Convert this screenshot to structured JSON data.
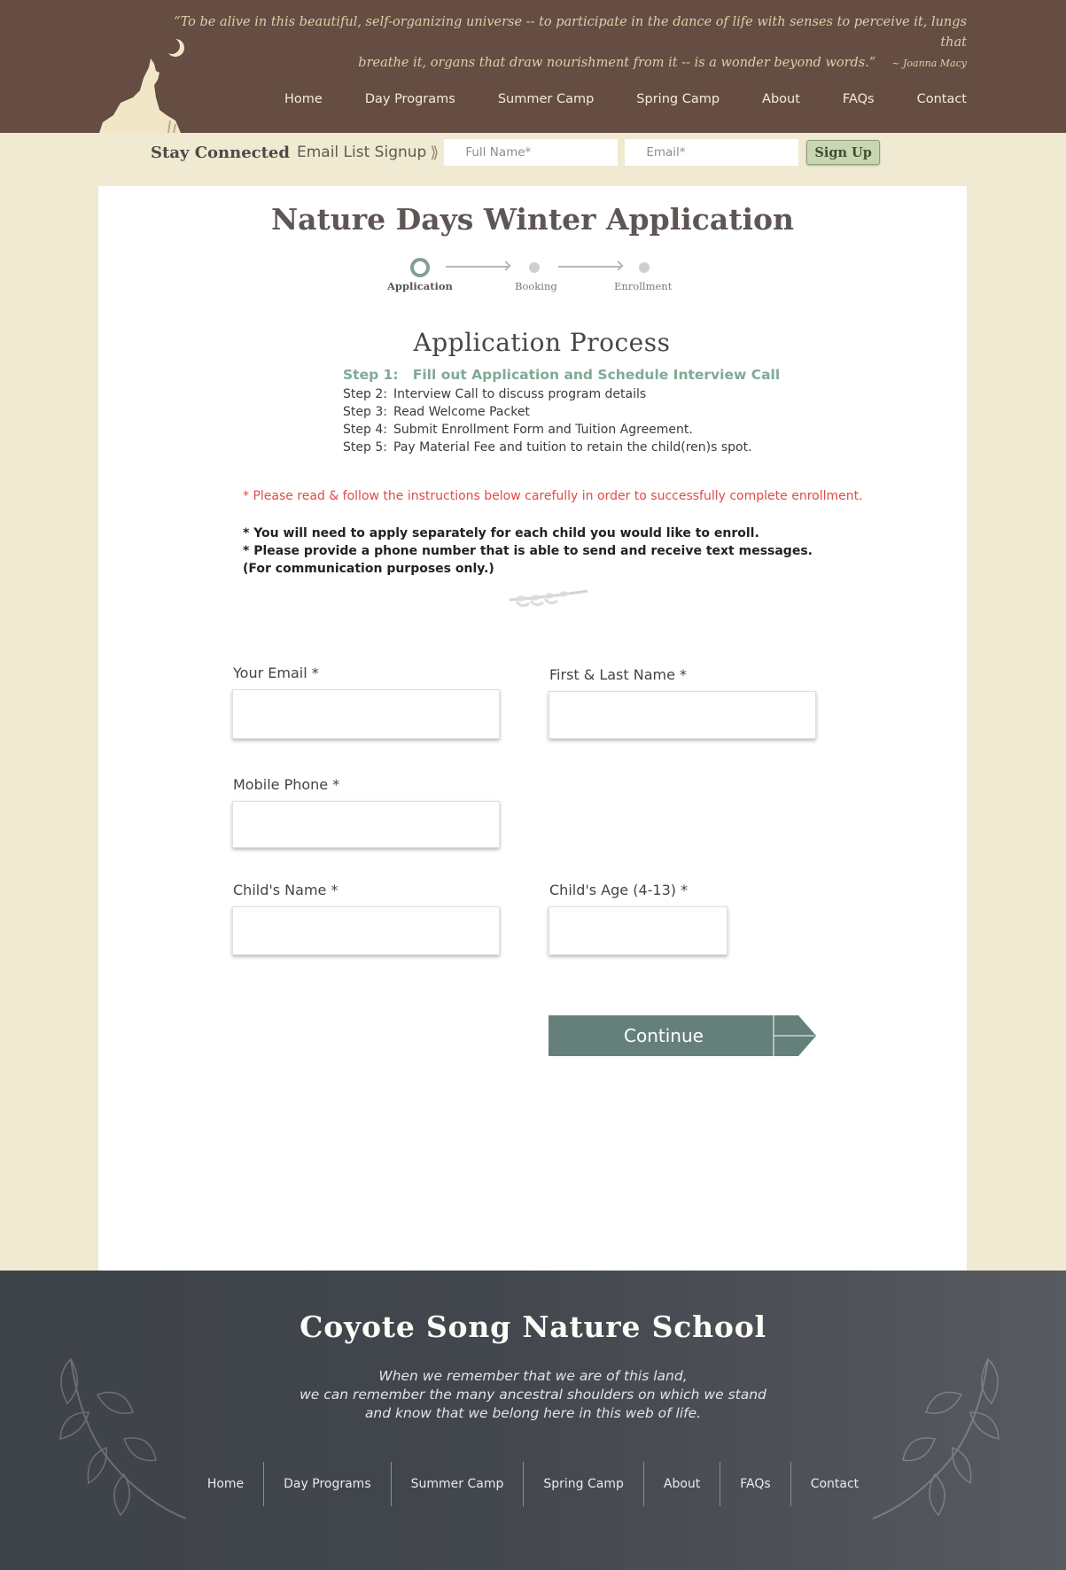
{
  "header": {
    "quote_line1": "“To be alive in this beautiful, self-organizing universe -- to participate in the dance of life with senses to perceive it, lungs that",
    "quote_line2": "breathe it, organs that draw nourishment from it -- is a wonder beyond words.”",
    "quote_author": "~ Joanna Macy",
    "logo_icon": "howling-coyote-moon-icon",
    "nav": [
      "Home",
      "Day Programs",
      "Summer Camp",
      "Spring Camp",
      "About",
      "FAQs",
      "Contact"
    ]
  },
  "signup": {
    "stay_connected": "Stay Connected",
    "email_list": "Email List Signup",
    "chevron": "⟫",
    "name_placeholder": "Full Name*",
    "email_placeholder": "Email*",
    "button": "Sign Up"
  },
  "form": {
    "title": "Nature Days Winter Application",
    "progress": [
      "Application",
      "Booking",
      "Enrollment"
    ],
    "active_step": "Application",
    "process_title": "Application Process",
    "step1_prefix": "Step 1:",
    "step1_text": "Fill out Application and Schedule Interview Call",
    "steps": [
      {
        "n": "Step 2:",
        "text": "Interview Call to discuss program details"
      },
      {
        "n": "Step 3:",
        "text": "Read Welcome Packet"
      },
      {
        "n": "Step 4:",
        "text": "Submit Enrollment Form and Tuition Agreement."
      },
      {
        "n": "Step 5:",
        "text": "Pay Material Fee and tuition to retain the child(ren)s spot."
      }
    ],
    "warning": "* Please read & follow the instructions below carefully in order to successfully complete enrollment.",
    "note1": "* You will need to apply separately for each child you would like to enroll.",
    "note2": "* Please provide a phone number that is able to send and receive text messages.",
    "note3": "(For communication purposes only.)",
    "fields": {
      "email": "Your Email *",
      "name": "First & Last Name *",
      "phone": "Mobile Phone *",
      "child_name": "Child's Name *",
      "child_age": "Child's Age (4-13) *"
    },
    "continue": "Continue"
  },
  "footer": {
    "title": "Coyote Song Nature School",
    "quote1": "When we remember that we are of this land,",
    "quote2": "we can remember the many ancestral shoulders on which we stand",
    "quote3": "and know that we belong here in this web of life.",
    "nav": [
      "Home",
      "Day Programs",
      "Summer Camp",
      "Spring Camp",
      "About",
      "FAQs",
      "Contact"
    ]
  },
  "colors": {
    "header_bg": "#654d43",
    "page_bg": "#efead1",
    "accent_green": "#7faa95",
    "button_green": "#65807a",
    "warning_red": "#e24b46",
    "footer_bg": "#42464d"
  }
}
